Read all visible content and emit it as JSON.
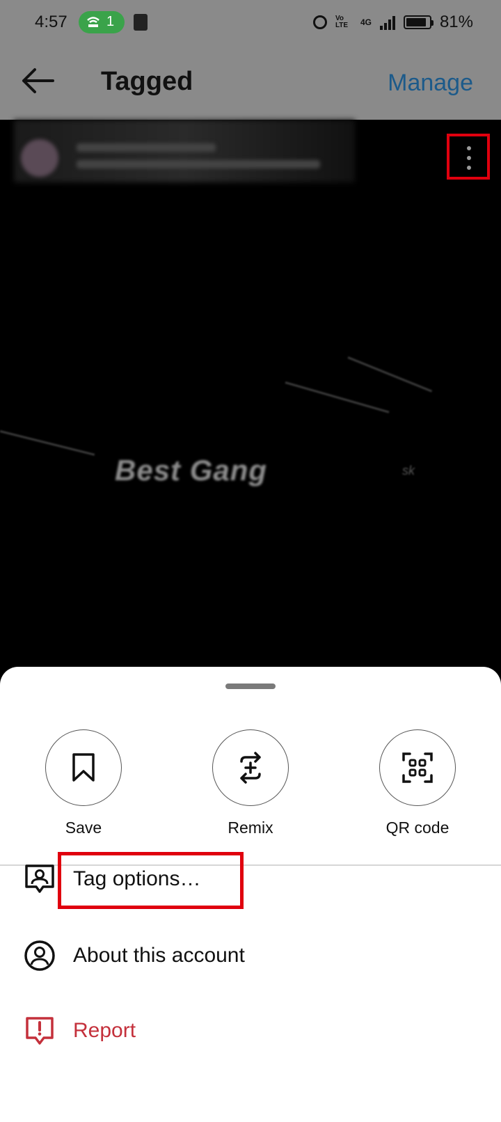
{
  "status_bar": {
    "time": "4:57",
    "hotspot_count": "1",
    "volte_label": "Vo LTE",
    "network_label": "4G",
    "battery": "81%"
  },
  "header": {
    "title": "Tagged",
    "manage_label": "Manage"
  },
  "post": {
    "image_text": "Best Gang",
    "image_small_text": "sk"
  },
  "sheet": {
    "actions": [
      {
        "label": "Save",
        "icon": "bookmark-icon"
      },
      {
        "label": "Remix",
        "icon": "remix-icon"
      },
      {
        "label": "QR code",
        "icon": "qr-code-icon"
      }
    ],
    "menu": [
      {
        "label": "Tag options…",
        "icon": "tag-person-icon"
      },
      {
        "label": "About this account",
        "icon": "account-circle-icon"
      },
      {
        "label": "Report",
        "icon": "report-icon",
        "color": "#c4303b"
      }
    ]
  },
  "colors": {
    "highlight": "#e0000e",
    "dim_overlay": "#8a8a8a",
    "link": "#1c5a8a",
    "report": "#c4303b"
  }
}
